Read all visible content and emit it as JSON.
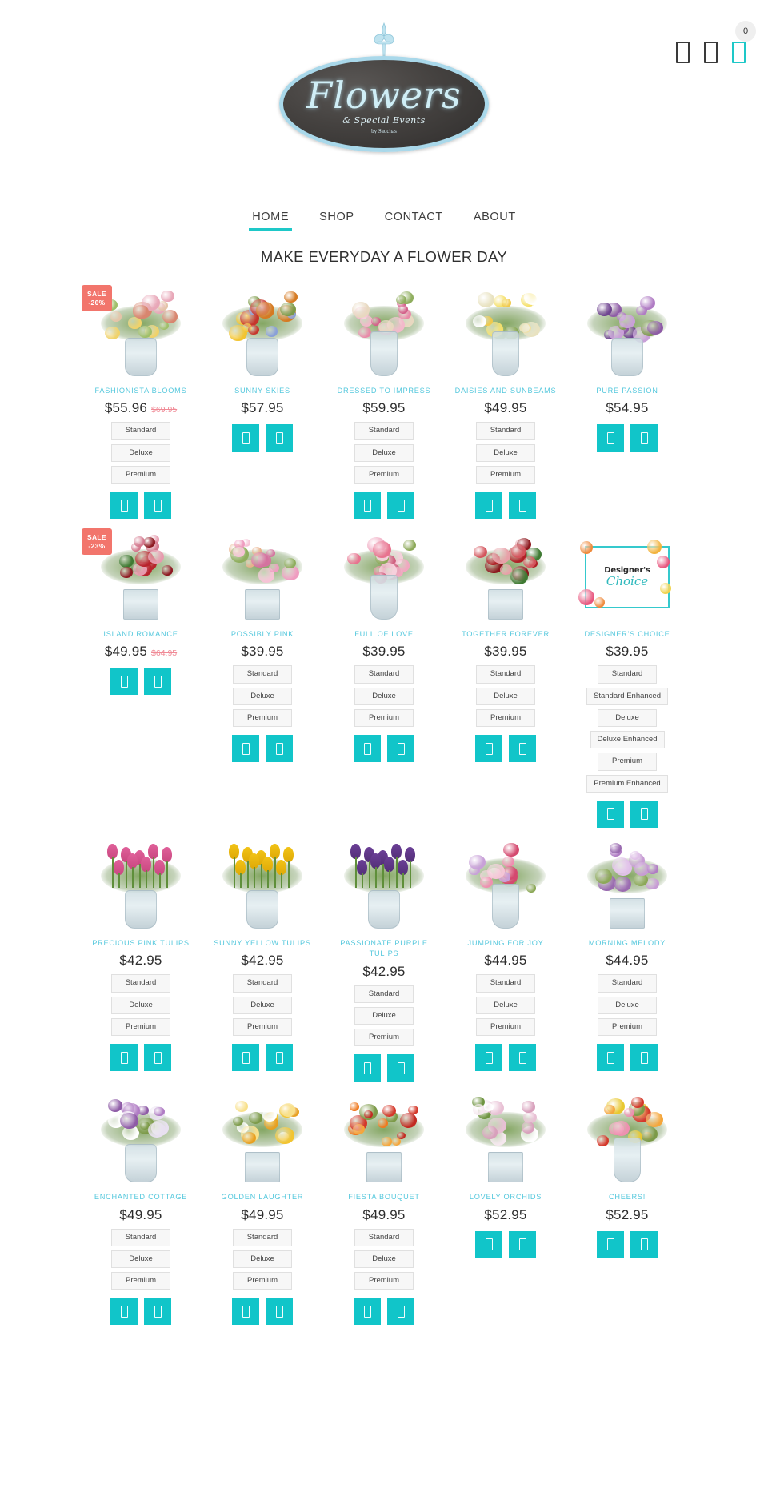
{
  "header": {
    "logo": {
      "script_text": "Flowers",
      "subtitle": "& Special Events",
      "byline": "by Sauchas",
      "fleur_icon": "fleur-de-lis-icon"
    },
    "icons": [
      {
        "name": "search-icon",
        "glyph": "□"
      },
      {
        "name": "user-account-icon",
        "glyph": "□"
      },
      {
        "name": "shopping-cart-icon",
        "glyph": "□"
      }
    ],
    "cart_count": "0",
    "accent_color": "#1ec8c8"
  },
  "nav": {
    "items": [
      {
        "label": "HOME",
        "active": true
      },
      {
        "label": "SHOP",
        "active": false
      },
      {
        "label": "CONTACT",
        "active": false
      },
      {
        "label": "ABOUT",
        "active": false
      }
    ]
  },
  "main": {
    "title": "MAKE EVERYDAY A FLOWER DAY",
    "action_buttons": [
      {
        "name": "quick-view-button",
        "glyph": "□"
      },
      {
        "name": "add-to-cart-button",
        "glyph": "□"
      }
    ],
    "products": [
      {
        "name": "FASHIONISTA BLOOMS",
        "price": "$55.96",
        "old_price": "$69.95",
        "sale_badge": "SALE\n-20%",
        "variants": [
          "Standard",
          "Deluxe",
          "Premium"
        ],
        "image": {
          "type": "bouquet",
          "vase": "vase",
          "colors": [
            "#e8a7b8",
            "#f0d26a",
            "#d8866f",
            "#9fbf6a",
            "#e4c4a8"
          ]
        }
      },
      {
        "name": "SUNNY SKIES",
        "price": "$57.95",
        "old_price": "",
        "sale_badge": "",
        "variants": [],
        "image": {
          "type": "bouquet",
          "vase": "vase",
          "colors": [
            "#f2c430",
            "#c6352c",
            "#8aa0d8",
            "#d57a22",
            "#7c9a48"
          ]
        }
      },
      {
        "name": "DRESSED TO IMPRESS",
        "price": "$59.95",
        "old_price": "",
        "sale_badge": "",
        "variants": [
          "Standard",
          "Deluxe",
          "Premium"
        ],
        "image": {
          "type": "bouquet",
          "vase": "tall",
          "colors": [
            "#e88aa8",
            "#f3b9cb",
            "#d4608a",
            "#e8d8c0",
            "#8fae5e"
          ]
        }
      },
      {
        "name": "DAISIES AND SUNBEAMS",
        "price": "$49.95",
        "old_price": "",
        "sale_badge": "",
        "variants": [
          "Standard",
          "Deluxe",
          "Premium"
        ],
        "image": {
          "type": "bouquet",
          "vase": "tall",
          "colors": [
            "#f5e06a",
            "#ffffff",
            "#e8e2c0",
            "#f0c94a",
            "#89a855"
          ]
        }
      },
      {
        "name": "PURE PASSION",
        "price": "$54.95",
        "old_price": "",
        "sale_badge": "",
        "variants": [],
        "image": {
          "type": "bouquet",
          "vase": "vase",
          "colors": [
            "#8e5ba6",
            "#b07cc4",
            "#6f4490",
            "#c9a0d8",
            "#7d9a4e"
          ]
        }
      },
      {
        "name": "ISLAND ROMANCE",
        "price": "$49.95",
        "old_price": "$64.95",
        "sale_badge": "SALE\n-23%",
        "variants": [],
        "image": {
          "type": "bouquet",
          "vase": "cube",
          "colors": [
            "#b8232c",
            "#e79aae",
            "#8e1a22",
            "#d4798e",
            "#3f7a33"
          ]
        }
      },
      {
        "name": "POSSIBLY PINK",
        "price": "$39.95",
        "old_price": "",
        "sale_badge": "",
        "variants": [
          "Standard",
          "Deluxe",
          "Premium"
        ],
        "image": {
          "type": "bouquet",
          "vase": "cube",
          "colors": [
            "#ef9cc0",
            "#f6c3d6",
            "#e8b08a",
            "#d4729f",
            "#8fae5e"
          ]
        }
      },
      {
        "name": "FULL OF LOVE",
        "price": "$39.95",
        "old_price": "",
        "sale_badge": "",
        "variants": [
          "Standard",
          "Deluxe",
          "Premium"
        ],
        "image": {
          "type": "bouquet",
          "vase": "tall",
          "colors": [
            "#f0a8c0",
            "#e8738f",
            "#f6d0dc",
            "#d06080",
            "#8ca858"
          ]
        }
      },
      {
        "name": "TOGETHER FOREVER",
        "price": "$39.95",
        "old_price": "",
        "sale_badge": "",
        "variants": [
          "Standard",
          "Deluxe",
          "Premium"
        ],
        "image": {
          "type": "bouquet",
          "vase": "cube",
          "colors": [
            "#b02026",
            "#8c161c",
            "#d4545c",
            "#e8a0a8",
            "#3f7a33"
          ]
        }
      },
      {
        "name": "DESIGNER'S CHOICE",
        "price": "$39.95",
        "old_price": "",
        "sale_badge": "",
        "variants": [
          "Standard",
          "Standard Enhanced",
          "Deluxe",
          "Deluxe Enhanced",
          "Premium",
          "Premium Enhanced"
        ],
        "image": {
          "type": "designer-card",
          "line1": "Designer's",
          "line2": "Choice"
        }
      },
      {
        "name": "PRECIOUS PINK TULIPS",
        "price": "$42.95",
        "old_price": "",
        "sale_badge": "",
        "variants": [
          "Standard",
          "Deluxe",
          "Premium"
        ],
        "image": {
          "type": "tulips",
          "vase": "vase",
          "colors": [
            "#e0609a",
            "#ef8ab4",
            "#c94880",
            "#f2aecb",
            "#5f8f3a"
          ]
        }
      },
      {
        "name": "SUNNY YELLOW TULIPS",
        "price": "$42.95",
        "old_price": "",
        "sale_badge": "",
        "variants": [
          "Standard",
          "Deluxe",
          "Premium"
        ],
        "image": {
          "type": "tulips",
          "vase": "vase",
          "colors": [
            "#f2c316",
            "#f8d84e",
            "#dfa907",
            "#fae98c",
            "#5f8f3a"
          ]
        }
      },
      {
        "name": "PASSIONATE PURPLE TULIPS",
        "price": "$42.95",
        "old_price": "",
        "sale_badge": "",
        "variants": [
          "Standard",
          "Deluxe",
          "Premium"
        ],
        "image": {
          "type": "tulips",
          "vase": "vase",
          "colors": [
            "#6b3f96",
            "#8c5bb4",
            "#532f78",
            "#a87cc8",
            "#5f8f3a"
          ]
        }
      },
      {
        "name": "JUMPING FOR JOY",
        "price": "$44.95",
        "old_price": "",
        "sale_badge": "",
        "variants": [
          "Standard",
          "Deluxe",
          "Premium"
        ],
        "image": {
          "type": "bouquet",
          "vase": "tall",
          "colors": [
            "#ef8fb0",
            "#d4496f",
            "#c8a0d8",
            "#f4c6d6",
            "#8ca858"
          ]
        }
      },
      {
        "name": "MORNING MELODY",
        "price": "$44.95",
        "old_price": "",
        "sale_badge": "",
        "variants": [
          "Standard",
          "Deluxe",
          "Premium"
        ],
        "image": {
          "type": "bouquet",
          "vase": "cube",
          "colors": [
            "#c79cd4",
            "#b07cc4",
            "#e0c0e8",
            "#9a6bb0",
            "#8ca858"
          ]
        }
      },
      {
        "name": "ENCHANTED COTTAGE",
        "price": "$49.95",
        "old_price": "",
        "sale_badge": "",
        "variants": [
          "Standard",
          "Deluxe",
          "Premium"
        ],
        "image": {
          "type": "bouquet",
          "vase": "vase",
          "colors": [
            "#b07cc4",
            "#ffffff",
            "#e8e0f0",
            "#8e5ba6",
            "#7c9a48"
          ]
        }
      },
      {
        "name": "GOLDEN LAUGHTER",
        "price": "$49.95",
        "old_price": "",
        "sale_badge": "",
        "variants": [
          "Standard",
          "Deluxe",
          "Premium"
        ],
        "image": {
          "type": "bouquet",
          "vase": "cube",
          "colors": [
            "#f2c430",
            "#ffffff",
            "#f8e08a",
            "#e8a020",
            "#7c9a48"
          ]
        }
      },
      {
        "name": "FIESTA BOUQUET",
        "price": "$49.95",
        "old_price": "",
        "sale_badge": "",
        "variants": [
          "Standard",
          "Deluxe",
          "Premium"
        ],
        "image": {
          "type": "bouquet",
          "vase": "cube",
          "colors": [
            "#ef7a20",
            "#d4382a",
            "#f4a63c",
            "#c22a22",
            "#7c9a48"
          ]
        }
      },
      {
        "name": "LOVELY ORCHIDS",
        "price": "$52.95",
        "old_price": "",
        "sale_badge": "",
        "variants": [],
        "image": {
          "type": "bouquet",
          "vase": "cube",
          "colors": [
            "#f6e8ef",
            "#e8c0d4",
            "#ffffff",
            "#d8a0bc",
            "#6f9440"
          ]
        }
      },
      {
        "name": "CHEERS!",
        "price": "$52.95",
        "old_price": "",
        "sale_badge": "",
        "variants": [],
        "image": {
          "type": "bouquet",
          "vase": "tall",
          "colors": [
            "#e8c830",
            "#d4382a",
            "#ef8fb0",
            "#f4a63c",
            "#7c9a48"
          ]
        }
      }
    ]
  }
}
